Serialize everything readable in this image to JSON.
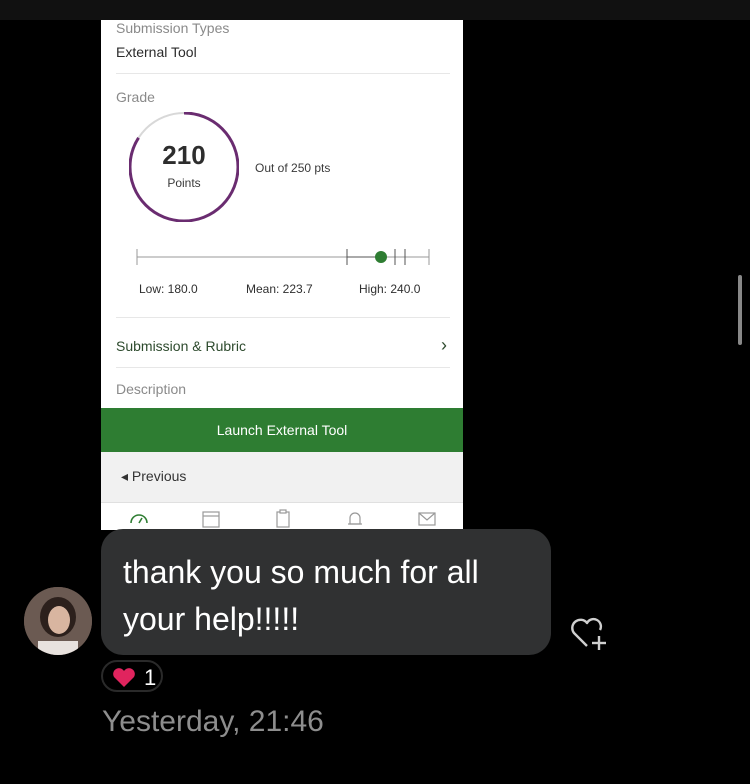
{
  "shared_screenshot": {
    "submission_types_label": "Submission Types",
    "submission_types_value": "External Tool",
    "grade_label": "Grade",
    "grade": {
      "score": "210",
      "unit": "Points",
      "out_of": "Out of 250 pts",
      "score_fraction": 0.84
    },
    "stats": {
      "low_label": "Low: 180.0",
      "mean_label": "Mean: 223.7",
      "high_label": "High: 240.0"
    },
    "submission_rubric_label": "Submission & Rubric",
    "description_label": "Description",
    "launch_button_label": "Launch External Tool",
    "previous_label": "◂ Previous",
    "accent_color": "#2e7d32",
    "ring_color": "#6a2c70"
  },
  "message": {
    "text": "thank you so much for all your help!!!!!",
    "reaction_emoji": "heart",
    "reaction_count": "1",
    "timestamp": "Yesterday, 21:46"
  },
  "colors": {
    "bubble": "#303132",
    "background": "#000000",
    "heart": "#e0245e"
  }
}
